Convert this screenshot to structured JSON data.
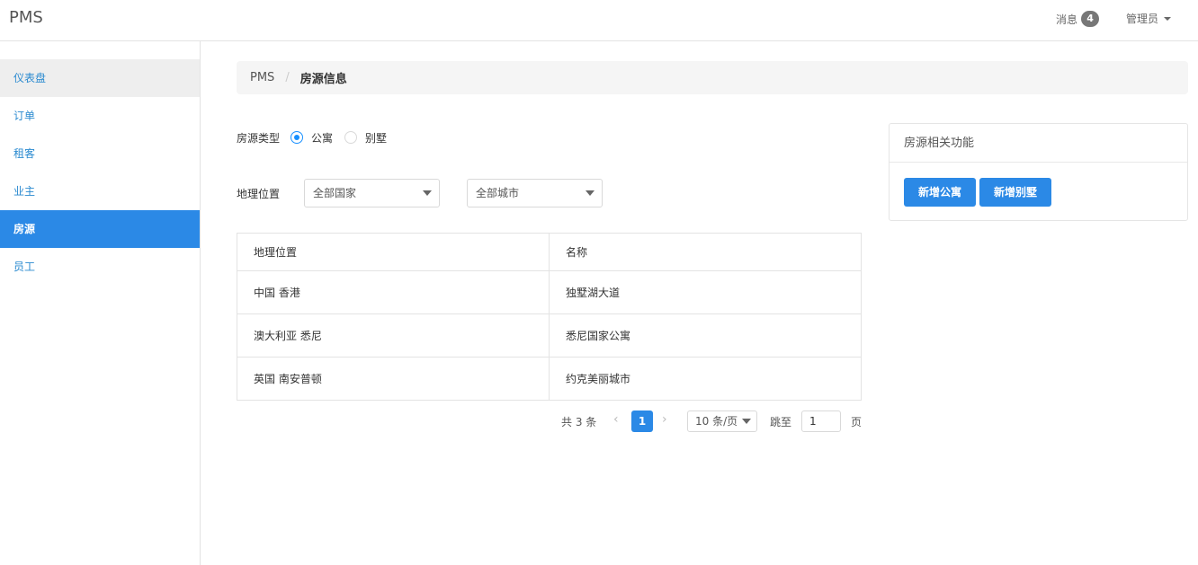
{
  "navbar": {
    "brand": "PMS",
    "messages_label": "消息",
    "messages_count": "4",
    "user": "管理员"
  },
  "sidebar": {
    "items": [
      {
        "label": "仪表盘"
      },
      {
        "label": "订单"
      },
      {
        "label": "租客"
      },
      {
        "label": "业主"
      },
      {
        "label": "房源"
      },
      {
        "label": "员工"
      }
    ]
  },
  "breadcrumb": {
    "root": "PMS",
    "sep": "/",
    "current": "房源信息"
  },
  "filters": {
    "type_label": "房源类型",
    "type_options": [
      {
        "label": "公寓",
        "checked": true
      },
      {
        "label": "别墅",
        "checked": false
      }
    ],
    "location_label": "地理位置",
    "country": "全部国家",
    "city": "全部城市"
  },
  "table": {
    "headers": [
      "地理位置",
      "名称"
    ],
    "rows": [
      [
        "中国 香港",
        "独墅湖大道"
      ],
      [
        "澳大利亚 悉尼",
        "悉尼国家公寓"
      ],
      [
        "英国 南安普顿",
        "约克美丽城市"
      ]
    ]
  },
  "pagination": {
    "total": "共 3 条",
    "current_page": "1",
    "page_size": "10 条/页",
    "jump_label": "跳至",
    "jump_value": "1",
    "unit": "页"
  },
  "panel": {
    "title": "房源相关功能",
    "buttons": [
      "新增公寓",
      "新增别墅"
    ]
  },
  "colors": {
    "primary": "#2b89e6",
    "link": "#2a8ad0"
  }
}
